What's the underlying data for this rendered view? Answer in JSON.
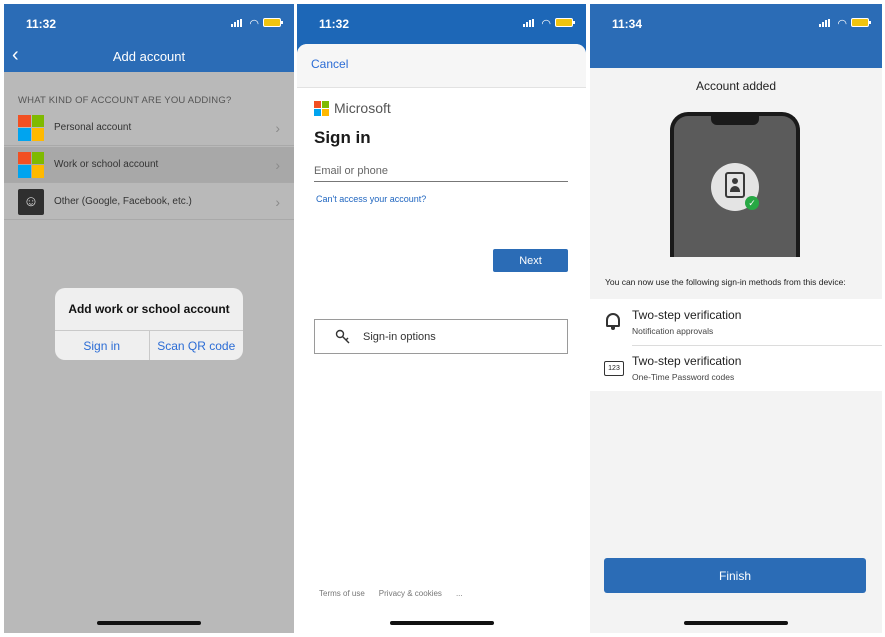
{
  "screen1": {
    "status_time": "11:32",
    "title": "Add account",
    "section_header": "WHAT KIND OF ACCOUNT ARE YOU ADDING?",
    "rows": [
      {
        "label": "Personal account"
      },
      {
        "label": "Work or school account"
      },
      {
        "label": "Other (Google, Facebook, etc.)"
      }
    ],
    "dialog": {
      "title": "Add work or school account",
      "sign_in": "Sign in",
      "scan_qr": "Scan QR code"
    }
  },
  "screen2": {
    "status_time": "11:32",
    "cancel": "Cancel",
    "brand": "Microsoft",
    "heading": "Sign in",
    "email_placeholder": "Email or phone",
    "cant_access": "Can't access your account?",
    "next": "Next",
    "signin_options": "Sign-in options",
    "footer": {
      "terms": "Terms of use",
      "privacy": "Privacy & cookies",
      "more": "..."
    }
  },
  "screen3": {
    "status_time": "11:34",
    "title": "Account added",
    "description": "You can now use the following sign-in methods from this device:",
    "methods": [
      {
        "title": "Two-step verification",
        "subtitle": "Notification approvals",
        "icon": "bell-icon"
      },
      {
        "title": "Two-step verification",
        "subtitle": "One-Time Password codes",
        "icon": "numpad-icon",
        "icon_text": "123"
      }
    ],
    "finish": "Finish"
  },
  "colors": {
    "accent": "#2b6cb6",
    "link": "#2b6cd5"
  }
}
